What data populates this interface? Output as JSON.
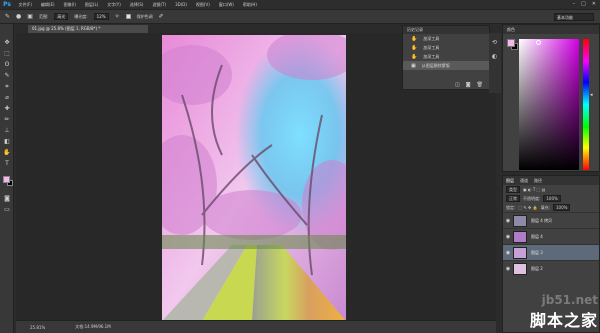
{
  "menubar": {
    "logo": "Ps",
    "items": [
      "文件(F)",
      "编辑(E)",
      "图像(I)",
      "图层(L)",
      "文字(Y)",
      "选择(S)",
      "滤镜(T)",
      "3D(D)",
      "视图(V)",
      "窗口(W)",
      "帮助(H)"
    ],
    "window_controls": [
      "–",
      "□",
      "✕"
    ]
  },
  "options": {
    "range_label": "范围:",
    "range_value": "高光",
    "exposure_label": "曝光度:",
    "exposure_value": "12%",
    "protect_label": "保护色调",
    "workspace": "基本功能"
  },
  "document": {
    "tab_title": "01.jpg @ 25.8% (图层 1, RGB/8*) *",
    "zoom": "25.81%",
    "doc_info": "文档:14.9M/96.1M"
  },
  "history": {
    "header": "历史记录",
    "items": [
      "加深工具",
      "加深工具",
      "加深工具",
      "从图层删除蒙版"
    ]
  },
  "color_panel": {
    "header": "颜色",
    "fg": "#f7b6f0",
    "bg": "#000000"
  },
  "layers": {
    "tabs": [
      "图层",
      "通道",
      "路径"
    ],
    "kind_label": "类型",
    "blend_mode": "正常",
    "opacity_label": "不透明度:",
    "opacity_value": "100%",
    "lock_label": "锁定:",
    "fill_label": "填充:",
    "fill_value": "100%",
    "items": [
      {
        "name": "图层 4 拷贝",
        "thumb": "#8c8aa8"
      },
      {
        "name": "图层 4",
        "thumb": "#b07cc8"
      },
      {
        "name": "图层 3",
        "thumb": "#c8a0d8"
      },
      {
        "name": "图层 2",
        "thumb": "#e0c0e0"
      }
    ]
  },
  "watermark": {
    "domain": "jb51.net",
    "name": "脚本之家"
  }
}
